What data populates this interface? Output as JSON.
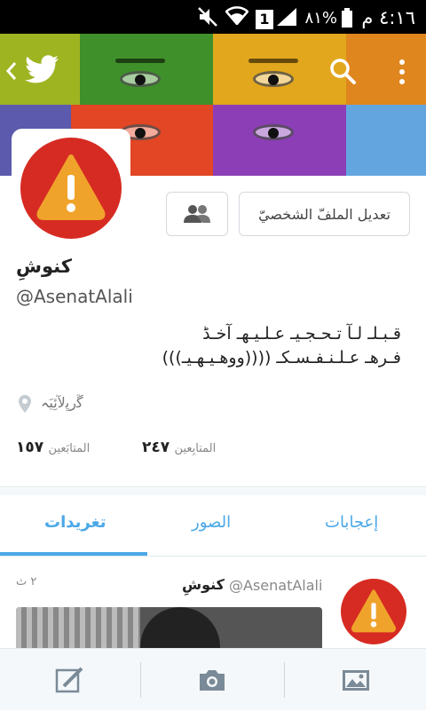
{
  "status_bar": {
    "time": "٤:١٦ م",
    "battery": "٨١%",
    "sim_slot": "1",
    "icons": [
      "mute-icon",
      "wifi-icon",
      "sim-icon",
      "signal-icon",
      "battery-icon"
    ]
  },
  "banner": {
    "colors": [
      "#3f8f2a",
      "#e2a71d",
      "#e24624",
      "#8b3eb5"
    ],
    "controls": [
      "back-icon",
      "twitter-bird-icon",
      "search-icon",
      "overflow-menu-icon"
    ]
  },
  "profile": {
    "display_name": "كنوشِ",
    "handle": "@AsenatAlali",
    "bio_line1": "قـبـلـ لـآ تـحـجـيـ عـلـيـهـ آخـڈ",
    "bio_line2": "فـرهـ عـلـنـفـسـكـ ((((ووهـيـهـيـ)))",
    "location": "ﮜرﭜلآئِيَہ",
    "edit_profile_label": "تعديل الملفّ الشخصيّ",
    "following_count": "٢٤٧",
    "following_label": "المتابِعين",
    "followers_count": "١٥٧",
    "followers_label": "المتابَعين",
    "avatar_color": "#d62b22",
    "avatar_warning_color": "#f0a32b"
  },
  "tabs": [
    {
      "label": "تغريدات",
      "active": true
    },
    {
      "label": "الصور",
      "active": false
    },
    {
      "label": "إعجابات",
      "active": false
    }
  ],
  "tweet": {
    "display_name": "كنوشِ",
    "handle": "@AsenatAlali",
    "time": "٢ ث"
  },
  "bottom_bar": {
    "icons": [
      "compose-icon",
      "camera-icon",
      "gallery-icon"
    ]
  },
  "accent": "#4aa8e8"
}
